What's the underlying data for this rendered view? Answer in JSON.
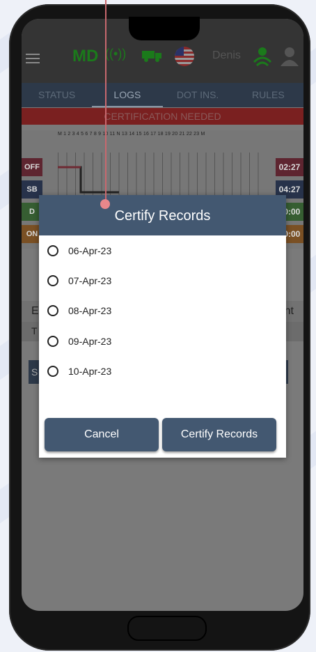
{
  "header": {
    "state_code": "MD",
    "username": "Denis",
    "signal_glyph": "((•))"
  },
  "tabs": [
    {
      "label": "STATUS"
    },
    {
      "label": "LOGS"
    },
    {
      "label": "DOT INS."
    },
    {
      "label": "RULES"
    }
  ],
  "banner": {
    "text": "CERTIFICATION NEEDED"
  },
  "log_grid": {
    "hour_labels": "M 1 2 3 4 5 6 7 8 9 10 11 N 13 14 15 16 17 18 19 20 21 22 23 M",
    "rows": [
      {
        "label": "OFF",
        "value": "02:27",
        "color": "#6e2a33"
      },
      {
        "label": "SB",
        "value": "04:27",
        "color": "#2d3a55"
      },
      {
        "label": "D",
        "value": "00:00",
        "color": "#3d6a38"
      },
      {
        "label": "ON",
        "value": "00:00",
        "color": "#8a5a28"
      }
    ]
  },
  "lower": {
    "row_left": "E",
    "row_right": "nt",
    "row2_left": "T",
    "row3_left": "S"
  },
  "dialog": {
    "title": "Certify Records",
    "options": [
      "06-Apr-23",
      "07-Apr-23",
      "08-Apr-23",
      "09-Apr-23",
      "10-Apr-23"
    ],
    "cancel_label": "Cancel",
    "certify_label": "Certify Records"
  },
  "colors": {
    "dialog_header": "#435871",
    "button": "#435871",
    "banner": "#7a2020",
    "pointer": "#e8878b"
  },
  "icons": [
    "menu-icon",
    "signal-icon",
    "truck-icon",
    "us-flag-icon",
    "driver-icon",
    "co-driver-icon"
  ]
}
